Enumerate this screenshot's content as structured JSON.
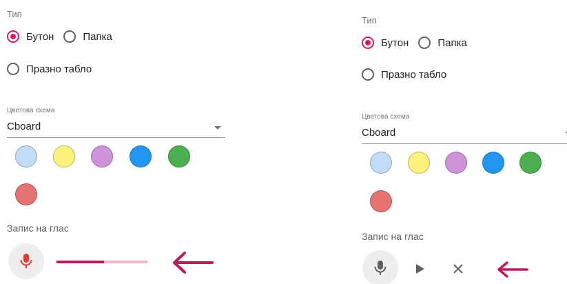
{
  "panels": [
    {
      "type_label": "Тип",
      "options": [
        "Бутон",
        "Папка",
        "Празно табло"
      ],
      "selected_option": "Бутон",
      "scheme_label": "Цветова схема",
      "scheme_value": "Cboard",
      "voice_label": "Запис на глас",
      "mic_state": "recording",
      "recording_progress_percent": 52
    },
    {
      "type_label": "Тип",
      "options": [
        "Бутон",
        "Папка",
        "Празно табло"
      ],
      "selected_option": "Бутон",
      "scheme_label": "Цветова схема",
      "scheme_value": "Cboard",
      "voice_label": "Запис на глас",
      "mic_state": "recorded",
      "controls": [
        "play-icon",
        "close-icon"
      ]
    }
  ],
  "swatch_colors": [
    "#c2dcf5",
    "#fff17c",
    "#cf93db",
    "#2196f3",
    "#4caf50",
    "#e57373"
  ],
  "colors": {
    "accent": "#d81b60",
    "mic_recording": "#e53935",
    "mic_idle": "#616161",
    "arrow": "#c2185b"
  },
  "icons": {
    "arrow": "arrow-left-icon",
    "mic": "mic-icon"
  }
}
